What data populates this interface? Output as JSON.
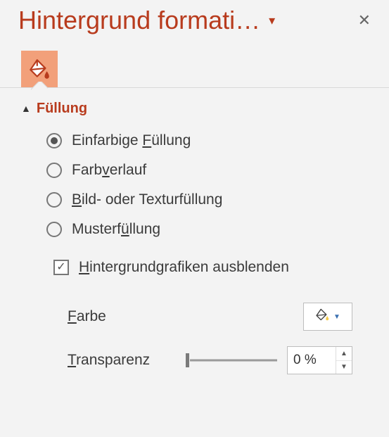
{
  "header": {
    "title": "Hintergrund formati…"
  },
  "section": {
    "title": "Füllung"
  },
  "fill": {
    "solid_pre": "Einfarbige ",
    "solid_u": "F",
    "solid_post": "üllung",
    "gradient_pre": "Farb",
    "gradient_u": "v",
    "gradient_post": "erlauf",
    "picture_pre": "",
    "picture_u": "B",
    "picture_post": "ild- oder Texturfüllung",
    "pattern_pre": "Musterf",
    "pattern_u": "ü",
    "pattern_post": "llung",
    "hide_pre": "",
    "hide_u": "H",
    "hide_post": "intergrundgrafiken ausblenden",
    "selected": "solid",
    "hide_graphics": true
  },
  "controls": {
    "color_pre": "",
    "color_u": "F",
    "color_post": "arbe",
    "transparency_pre": "",
    "transparency_u": "T",
    "transparency_post": "ransparenz",
    "transparency_value": "0 %"
  }
}
